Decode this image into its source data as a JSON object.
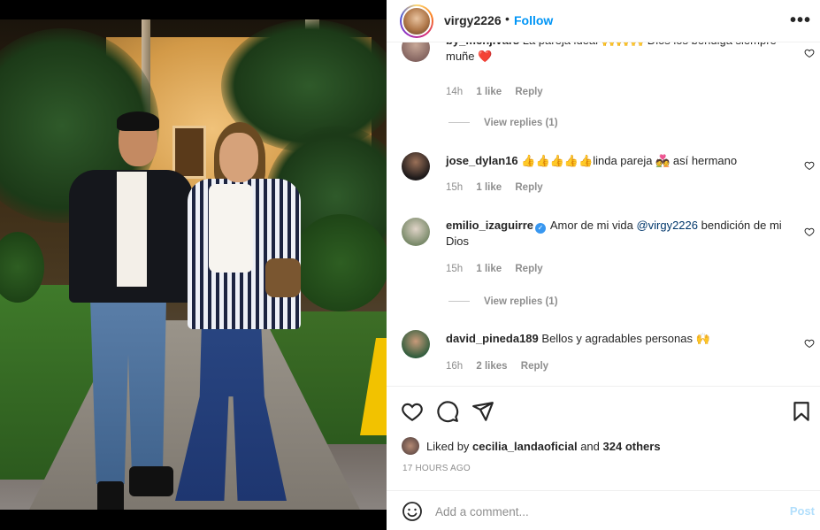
{
  "post_header": {
    "username": "virgy2226",
    "separator": "•",
    "follow_label": "Follow",
    "more_label": "•••"
  },
  "comments": [
    {
      "username": "by_menjivars",
      "text": "La pareja ideal 🙌🙌🙌 Dios los bendiga siempre muñe",
      "emoji": "❤️",
      "time": "14h",
      "likes": "1 like",
      "reply": "Reply",
      "view_replies": "View replies (1)"
    },
    {
      "username": "jose_dylan16",
      "text_emoji": "👍👍👍👍👍",
      "text": "linda pareja",
      "emoji2": "💑",
      "text2": " así hermano",
      "time": "15h",
      "likes": "1 like",
      "reply": "Reply"
    },
    {
      "username": "emilio_izaguirre",
      "text": "Amor de mi vida",
      "mention": "@virgy2226",
      "text2": " bendición de mi Dios",
      "time": "15h",
      "likes": "1 like",
      "reply": "Reply",
      "view_replies": "View replies (1)"
    },
    {
      "username": "david_pineda189",
      "text": "Bellos y agradables personas",
      "emoji": "🙌",
      "time": "16h",
      "likes": "2 likes",
      "reply": "Reply"
    }
  ],
  "likes": {
    "prefix": "Liked by",
    "user": "cecilia_landaoficial",
    "and": "and",
    "others": "324 others"
  },
  "timestamp": "17 HOURS AGO",
  "add_comment": {
    "placeholder": "Add a comment...",
    "post_label": "Post"
  },
  "colors": {
    "accent": "#0095f6",
    "post_disabled": "#b2dffc",
    "muted": "#8e8e8e",
    "heart": "#ed4956"
  }
}
